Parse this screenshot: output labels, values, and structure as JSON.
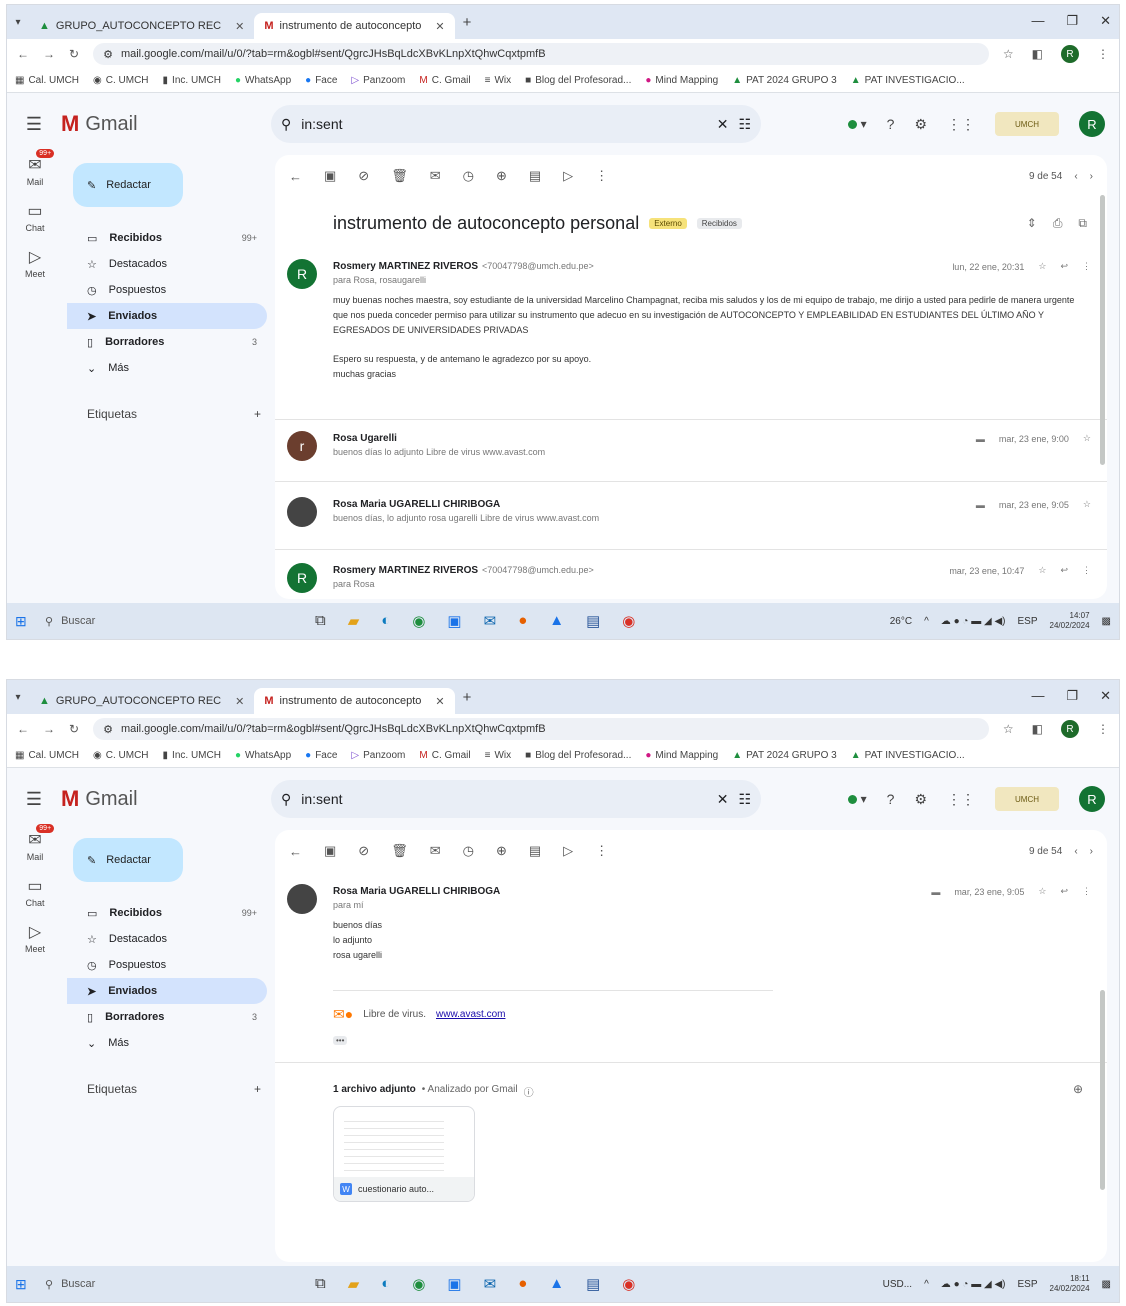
{
  "screen1": {
    "tabs": [
      {
        "label": "GRUPO_AUTOCONCEPTO REC",
        "icon": "drive-icon"
      },
      {
        "label": "instrumento de autoconcepto",
        "icon": "gmail-icon"
      }
    ],
    "url": "mail.google.com/mail/u/0/?tab=rm&ogbl#sent/QgrcJHsBqLdcXBvKLnpXtQhwCqxtpmfB",
    "search": "in:sent",
    "pager": "9 de 54",
    "subject": "instrumento de autoconcepto personal",
    "chip_external": "Externo",
    "chip_received": "Recibidos",
    "messages": [
      {
        "initial": "R",
        "sender": "Rosmery MARTINEZ RIVEROS",
        "sender_addr": "<70047798@umch.edu.pe>",
        "to": "para Rosa, rosaugarelli",
        "date": "lun, 22 ene, 20:31",
        "body1": "muy buenas noches maestra, soy estudiante de la universidad Marcelino Champagnat, reciba mis saludos y los de mi equipo de trabajo, me dirijo a usted para pedirle de manera urgente que nos pueda conceder permiso para utilizar su instrumento que adecuo en su investigación de AUTOCONCEPTO Y EMPLEABILIDAD EN ESTUDIANTES DEL ÚLTIMO AÑO Y EGRESADOS DE UNIVERSIDADES PRIVADAS",
        "body2": "Espero su respuesta, y de antemano le agradezco por su apoyo.",
        "body3": "muchas gracias"
      },
      {
        "initial": "r",
        "sender": "Rosa Ugarelli",
        "snippet": "buenos días lo adjunto Libre de virus www.avast.com",
        "date": "mar, 23 ene, 9:00"
      },
      {
        "sender": "Rosa Maria UGARELLI CHIRIBOGA",
        "snippet": "buenos días, lo adjunto rosa ugarelli Libre de virus www.avast.com",
        "date": "mar, 23 ene, 9:05"
      },
      {
        "initial": "R",
        "sender": "Rosmery MARTINEZ RIVEROS",
        "sender_addr": "<70047798@umch.edu.pe>",
        "to": "para Rosa",
        "date": "mar, 23 ene, 10:47"
      }
    ],
    "clock_time": "14:07",
    "clock_date": "24/02/2024",
    "weather": "26°C"
  },
  "screen2": {
    "tabs": [
      {
        "label": "GRUPO_AUTOCONCEPTO REC",
        "icon": "drive-icon"
      },
      {
        "label": "instrumento de autoconcepto",
        "icon": "gmail-icon"
      }
    ],
    "url": "mail.google.com/mail/u/0/?tab=rm&ogbl#sent/QgrcJHsBqLdcXBvKLnpXtQhwCqxtpmfB",
    "search": "in:sent",
    "pager": "9 de 54",
    "sender": "Rosa Maria UGARELLI CHIRIBOGA",
    "to": "para mí",
    "date": "mar, 23 ene, 9:05",
    "body_lines": [
      "buenos días",
      "lo adjunto",
      "rosa ugarelli"
    ],
    "avast_text": "Libre de virus.",
    "avast_link": "www.avast.com",
    "ellipsis": "•••",
    "attach_title": "1 archivo adjunto",
    "attach_scan": "• Analizado por Gmail",
    "attach_name": "cuestionario auto...",
    "clock_time": "18:11",
    "clock_date": "24/02/2024",
    "weather": "USD..."
  },
  "common": {
    "bookmarks": [
      "Cal. UMCH",
      "C. UMCH",
      "Inc. UMCH",
      "WhatsApp",
      "Face",
      "Panzoom",
      "C. Gmail",
      "Wix",
      "Blog del Profesorad...",
      "Mind Mapping",
      "PAT 2024 GRUPO 3",
      "PAT INVESTIGACIO..."
    ],
    "gmail_label": "Gmail",
    "compose": "Redactar",
    "nav": [
      "Recibidos",
      "Destacados",
      "Pospuestos",
      "Enviados",
      "Borradores",
      "Más"
    ],
    "inbox_count": "99+",
    "drafts_count": "3",
    "labels_heading": "Etiquetas",
    "rail": [
      "Mail",
      "Chat",
      "Meet"
    ],
    "rail_badge": "99+",
    "avatar_initial": "R",
    "taskbar_search": "Buscar",
    "tray_lang": "ESP"
  }
}
